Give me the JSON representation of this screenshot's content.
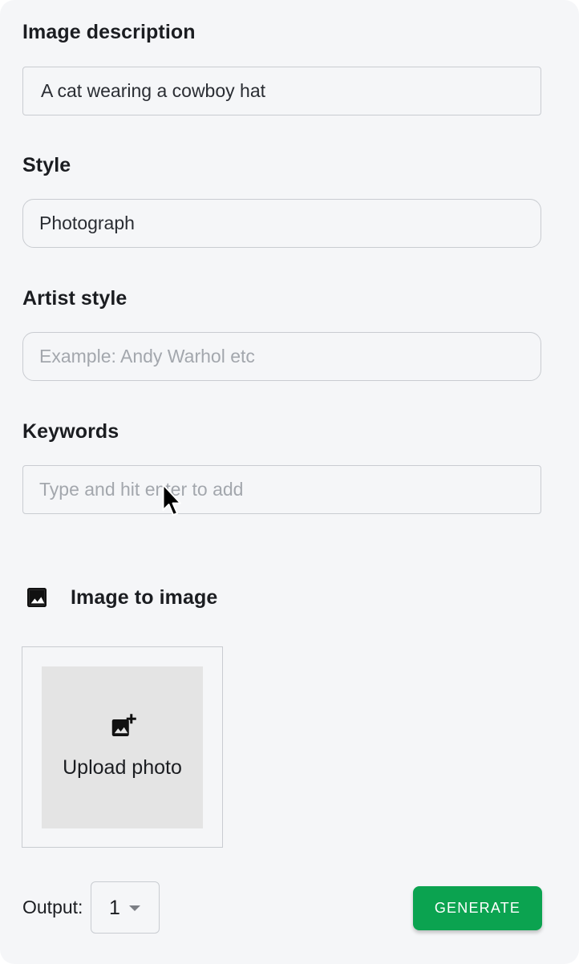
{
  "form": {
    "description": {
      "label": "Image description",
      "value": "A cat wearing a cowboy hat"
    },
    "style": {
      "label": "Style",
      "value": "Photograph"
    },
    "artist_style": {
      "label": "Artist style",
      "placeholder": "Example: Andy Warhol etc"
    },
    "keywords": {
      "label": "Keywords",
      "placeholder": "Type and hit enter to add"
    }
  },
  "image_to_image": {
    "title": "Image to image",
    "icon": "image-icon",
    "upload": {
      "label": "Upload photo",
      "icon": "add-photo-icon"
    }
  },
  "footer": {
    "output_label": "Output:",
    "output_value": "1",
    "generate_label": "GENERATE"
  },
  "colors": {
    "panel_background": "#f5f6f8",
    "primary_button": "#0ba350",
    "upload_tile": "#e4e4e4",
    "border": "#c9ccd1"
  }
}
